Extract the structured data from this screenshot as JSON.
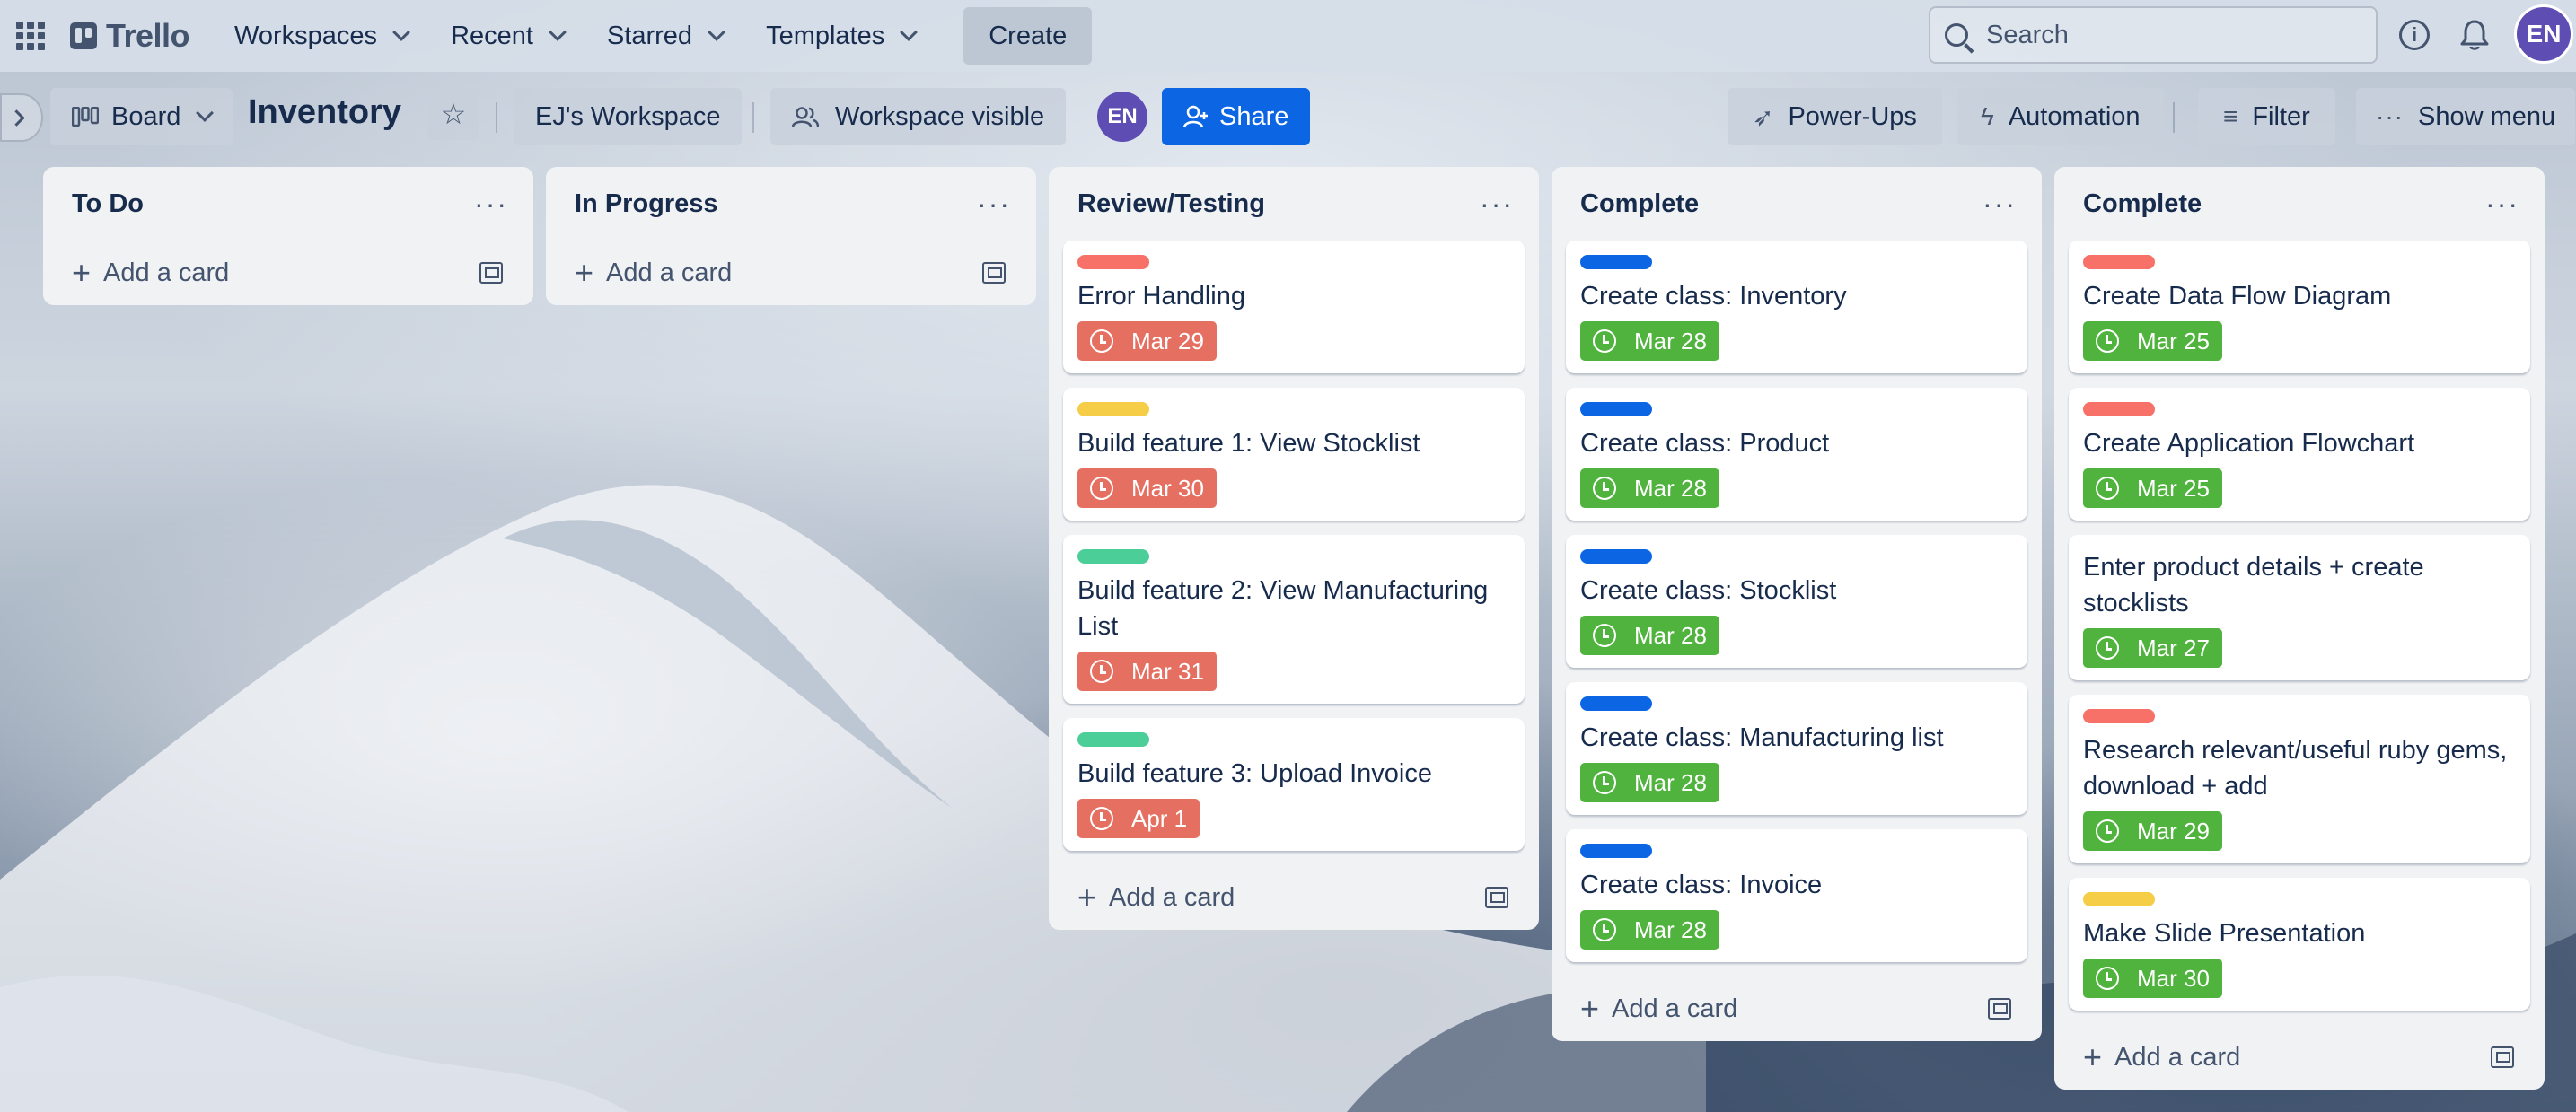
{
  "colors": {
    "label_red": "#f87168",
    "label_yellow": "#f5cd47",
    "label_green": "#4bce97",
    "label_blue": "#0c66e4",
    "due_overdue": "#e56f60",
    "due_complete": "#4fb33d",
    "share": "#0c66e4",
    "avatar": "#5e4db2"
  },
  "header": {
    "app_name": "Trello",
    "nav": {
      "workspaces": "Workspaces",
      "recent": "Recent",
      "starred": "Starred",
      "templates": "Templates",
      "create": "Create"
    },
    "search_label": "Search",
    "avatar_initials": "EN"
  },
  "boardbar": {
    "view_label": "Board",
    "board_title": "Inventory",
    "workspace_label": "EJ's Workspace",
    "visibility_label": "Workspace visible",
    "member_initials": "EN",
    "share_label": "Share",
    "powerups_label": "Power-Ups",
    "automation_label": "Automation",
    "filter_label": "Filter",
    "menu_label": "Show menu"
  },
  "add_card_label": "Add a card",
  "lists": [
    {
      "title": "To Do",
      "cards": []
    },
    {
      "title": "In Progress",
      "cards": []
    },
    {
      "title": "Review/Testing",
      "cards": [
        {
          "label": "red",
          "title": "Error Handling",
          "due": "Mar 29",
          "status": "overdue"
        },
        {
          "label": "yellow",
          "title": "Build feature 1: View Stocklist",
          "due": "Mar 30",
          "status": "overdue"
        },
        {
          "label": "green",
          "title": "Build feature 2: View Manufacturing List",
          "due": "Mar 31",
          "status": "overdue"
        },
        {
          "label": "green",
          "title": "Build feature 3: Upload Invoice",
          "due": "Apr 1",
          "status": "overdue"
        }
      ]
    },
    {
      "title": "Complete",
      "cards": [
        {
          "label": "blue",
          "title": "Create class: Inventory",
          "due": "Mar 28",
          "status": "complete"
        },
        {
          "label": "blue",
          "title": "Create class: Product",
          "due": "Mar 28",
          "status": "complete"
        },
        {
          "label": "blue",
          "title": "Create class: Stocklist",
          "due": "Mar 28",
          "status": "complete"
        },
        {
          "label": "blue",
          "title": "Create class: Manufacturing list",
          "due": "Mar 28",
          "status": "complete"
        },
        {
          "label": "blue",
          "title": "Create class: Invoice",
          "due": "Mar 28",
          "status": "complete"
        }
      ]
    },
    {
      "title": "Complete",
      "cards": [
        {
          "label": "red",
          "title": "Create Data Flow Diagram",
          "due": "Mar 25",
          "status": "complete"
        },
        {
          "label": "red",
          "title": "Create Application Flowchart",
          "due": "Mar 25",
          "status": "complete"
        },
        {
          "label": null,
          "title": "Enter product details + create stocklists",
          "due": "Mar 27",
          "status": "complete"
        },
        {
          "label": "red",
          "title": "Research relevant/useful ruby gems, download + add",
          "due": "Mar 29",
          "status": "complete"
        },
        {
          "label": "yellow",
          "title": "Make Slide Presentation",
          "due": "Mar 30",
          "status": "complete"
        }
      ]
    }
  ]
}
